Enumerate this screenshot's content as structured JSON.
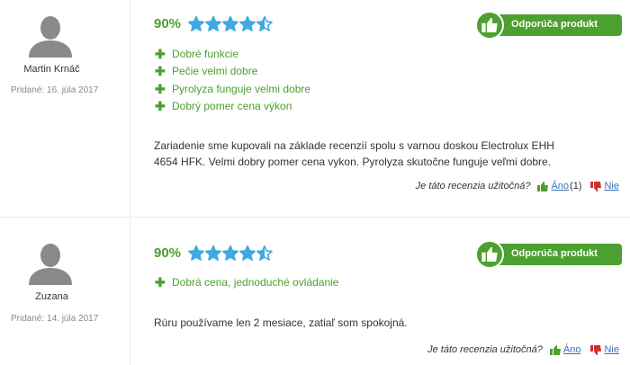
{
  "reviews": [
    {
      "author": "Martin Krnáč",
      "added": "Pridané: 16. júla 2017",
      "rating_percent": "90%",
      "stars": 4.5,
      "recommend_label": "Odporúča produkt",
      "pros": [
        "Dobré funkcie",
        "Pečie velmi dobre",
        "Pyrolyza funguje velmi dobre",
        "Dobrý pomer cena výkon"
      ],
      "text": "Zariadenie sme kupovali na základe recenzií spolu s varnou doskou Electrolux EHH 4654 HFK. Velmi dobry pomer cena vykon. Pyrolyza skutočne funguje veľmi dobre.",
      "helpful_question": "Je táto recenzia užitočná?",
      "yes_label": "Áno",
      "yes_count": "(1)",
      "no_label": "Nie"
    },
    {
      "author": "Zuzana",
      "added": "Pridané: 14. júla 2017",
      "rating_percent": "90%",
      "stars": 4.5,
      "recommend_label": "Odporúča produkt",
      "pros": [
        "Dobrá cena, jednoduché ovládanie"
      ],
      "text": "Rúru používame len 2 mesiace, zatiaľ som spokojná.",
      "helpful_question": "Je táto recenzia užitočná?",
      "yes_label": "Áno",
      "yes_count": "",
      "no_label": "Nie"
    }
  ],
  "colors": {
    "accent_green": "#4ca02f",
    "star_blue": "#3fa9e0",
    "link_blue": "#3a6fb5",
    "thumb_down_red": "#d0312d"
  },
  "icons": {
    "avatar": "user-silhouette-icon",
    "star": "star-icon",
    "plus": "plus-icon",
    "thumbs_up": "thumbs-up-icon",
    "thumbs_down": "thumbs-down-icon"
  }
}
